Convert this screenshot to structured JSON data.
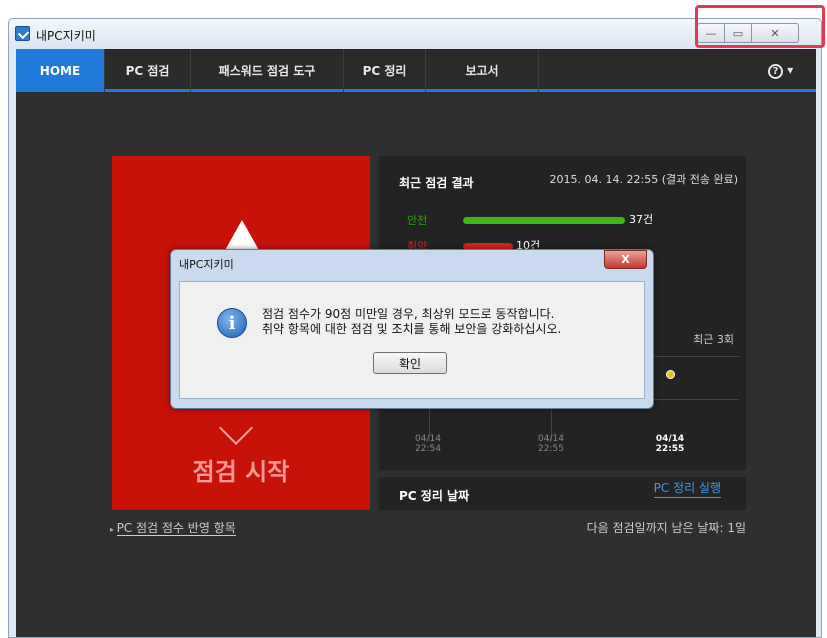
{
  "window": {
    "title": "내PC지키미",
    "controls": {
      "minimize": "—",
      "maximize": "▭",
      "close": "✕"
    }
  },
  "nav": {
    "tabs": [
      "HOME",
      "PC 점검",
      "패스워드 점검 도구",
      "PC 정리",
      "보고서"
    ],
    "help": "▾"
  },
  "start": {
    "label": "점검 시작"
  },
  "recent": {
    "title": "최근 점검 결과",
    "datetime": "2015. 04. 14. 22:55 (결과 전송 완료)",
    "safe_label": "안전",
    "safe_count": "37건",
    "weak_label": "취약",
    "weak_count": "10건",
    "chart_range_label": "최근 3회",
    "x_ticks": [
      {
        "date": "04/14",
        "time": "22:54"
      },
      {
        "date": "04/14",
        "time": "22:55"
      },
      {
        "date": "04/14",
        "time": "22:55"
      }
    ]
  },
  "clean": {
    "title": "PC 정리 날짜",
    "action": "PC 정리 실행"
  },
  "footer": {
    "mirror_link": "PC 점검 점수 반영 항목",
    "remaining": "다음 점검일까지 남은 날짜: 1일"
  },
  "dialog": {
    "title": "내PC지키미",
    "message_line1": "점검 점수가 90점 미만일 경우, 최상위 모드로 동작합니다.",
    "message_line2": "취약 항목에 대한 점검 및 조치를 통해 보안을 강화하십시오.",
    "ok": "확인",
    "close": "X"
  },
  "colors": {
    "accent": "#1f7ad9",
    "danger": "#c81109",
    "safe": "#3eb51a"
  }
}
